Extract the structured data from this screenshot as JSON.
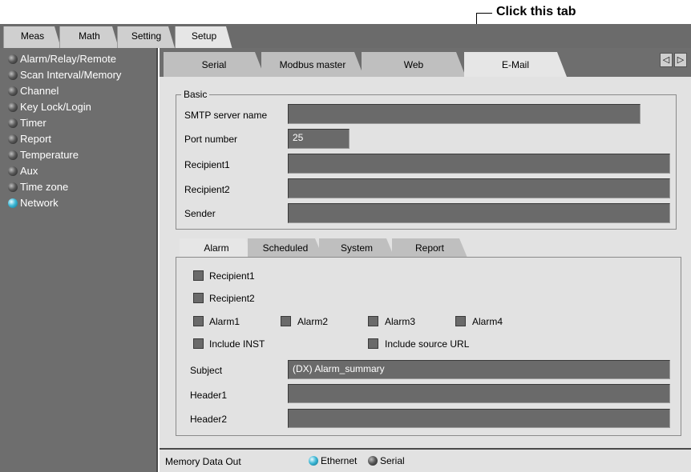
{
  "annotation": {
    "text": "Click this tab"
  },
  "top_tabs": [
    "Meas",
    "Math",
    "Setting",
    "Setup"
  ],
  "sidebar": {
    "items": [
      {
        "label": "Alarm/Relay/Remote"
      },
      {
        "label": "Scan Interval/Memory"
      },
      {
        "label": "Channel"
      },
      {
        "label": "Key Lock/Login"
      },
      {
        "label": "Timer"
      },
      {
        "label": "Report"
      },
      {
        "label": "Temperature"
      },
      {
        "label": "Aux"
      },
      {
        "label": "Time zone"
      },
      {
        "label": "Network"
      }
    ],
    "selected": "Network"
  },
  "sub_tabs": [
    "Serial",
    "Modbus master",
    "Web",
    "E-Mail"
  ],
  "active_sub_tab": "E-Mail",
  "basic": {
    "legend": "Basic",
    "smtp_label": "SMTP server name",
    "smtp_value": "",
    "port_label": "Port number",
    "port_value": "25",
    "recipient1_label": "Recipient1",
    "recipient1_value": "",
    "recipient2_label": "Recipient2",
    "recipient2_value": "",
    "sender_label": "Sender",
    "sender_value": ""
  },
  "inner_tabs": [
    "Alarm",
    "Scheduled",
    "System",
    "Report"
  ],
  "active_inner_tab": "Alarm",
  "alarm": {
    "recipient1": "Recipient1",
    "recipient2": "Recipient2",
    "alarm1": "Alarm1",
    "alarm2": "Alarm2",
    "alarm3": "Alarm3",
    "alarm4": "Alarm4",
    "include_inst": "Include INST",
    "include_url": "Include source URL",
    "subject_label": "Subject",
    "subject_value": "(DX) Alarm_summary",
    "header1_label": "Header1",
    "header1_value": "",
    "header2_label": "Header2",
    "header2_value": ""
  },
  "memory_data_out": {
    "label": "Memory Data Out",
    "options": [
      "Ethernet",
      "Serial"
    ],
    "selected": "Ethernet"
  },
  "icons": {
    "prev": "triangle-left-icon",
    "next": "triangle-right-icon"
  }
}
